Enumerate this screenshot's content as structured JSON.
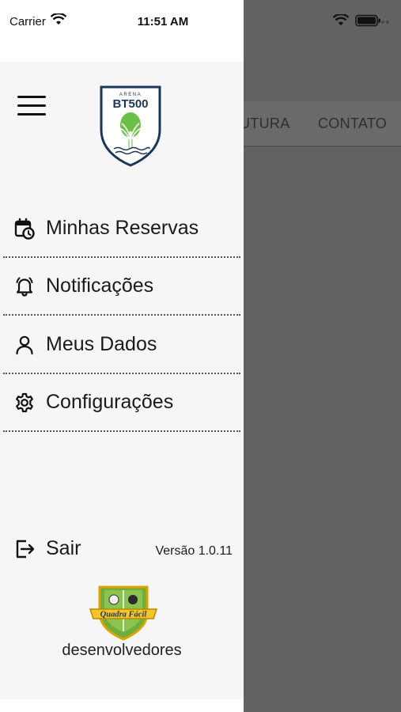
{
  "status_bar": {
    "carrier": "Carrier",
    "time": "11:51 AM"
  },
  "background": {
    "tabs": [
      "UTURA",
      "CONTATO"
    ]
  },
  "drawer": {
    "logo": {
      "top_text": "ARENA",
      "brand_text": "BT500",
      "icon": "palm-tree-racket-icon"
    },
    "menu_icon": "hamburger-icon",
    "menu": [
      {
        "label": "Minhas Reservas",
        "icon": "calendar-clock-icon"
      },
      {
        "label": "Notificações",
        "icon": "bell-icon"
      },
      {
        "label": "Meus Dados",
        "icon": "user-icon"
      },
      {
        "label": "Configurações",
        "icon": "gear-icon"
      }
    ],
    "logout": {
      "label": "Sair",
      "icon": "logout-icon"
    },
    "version": "Versão 1.0.11",
    "developer": {
      "badge_text": "Quadra Fácil",
      "label": "desenvolvedores"
    }
  },
  "colors": {
    "drawer_bg": "#f6f6f6",
    "overlay": "#626262",
    "brand_navy": "#1d3557",
    "brand_green": "#6cc04a"
  }
}
